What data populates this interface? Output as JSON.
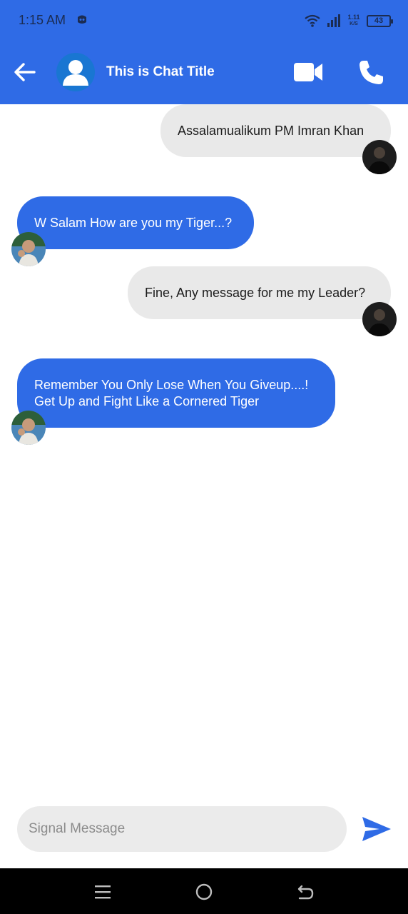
{
  "status_bar": {
    "time": "1:15 AM",
    "net_speed_value": "1.11",
    "net_speed_unit": "K/S",
    "battery_level": "43"
  },
  "header": {
    "title": "This is Chat Title",
    "back_icon": "arrow-left-icon",
    "avatar_icon": "person-icon",
    "video_icon": "video-camera-icon",
    "call_icon": "phone-icon"
  },
  "messages": [
    {
      "direction": "sent",
      "text": "Assalamualikum PM Imran Khan"
    },
    {
      "direction": "received",
      "text": "W Salam How are you my Tiger...?"
    },
    {
      "direction": "sent",
      "text": "Fine, Any message for me my Leader?"
    },
    {
      "direction": "received",
      "text": "Remember You Only Lose When You Giveup....!\nGet Up and Fight Like a Cornered Tiger"
    }
  ],
  "composer": {
    "placeholder": "Signal Message",
    "send_icon": "send-icon"
  },
  "colors": {
    "accent": "#2f6be6",
    "sent_bubble": "#e9e9e9",
    "received_bubble": "#2f6be6",
    "nav_bar": "#000000"
  }
}
